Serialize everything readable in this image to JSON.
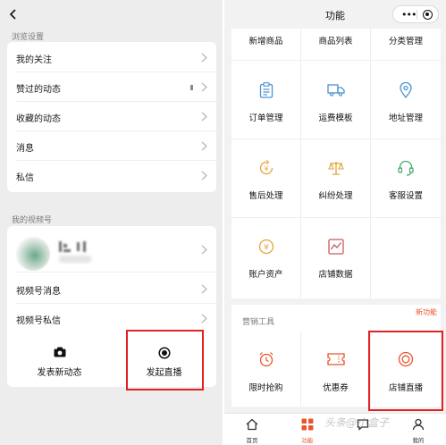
{
  "left_panel": {
    "browse_section_label": "浏览设置",
    "browse_items": [
      {
        "label": "我的关注"
      },
      {
        "label": "赞过的动态"
      },
      {
        "label": "收藏的动态"
      },
      {
        "label": "消息"
      },
      {
        "label": "私信"
      }
    ],
    "channels_section_label": "我的视频号",
    "channel_items": [
      {
        "label": "视频号消息"
      },
      {
        "label": "视频号私信"
      }
    ],
    "actions": {
      "post_label": "发表新动态",
      "live_label": "发起直播"
    }
  },
  "right_panel": {
    "title": "功能",
    "top_row": [
      "新增商品",
      "商品列表",
      "分类管理"
    ],
    "features": [
      {
        "label": "订单管理",
        "icon": "clipboard-icon"
      },
      {
        "label": "运费模板",
        "icon": "truck-icon"
      },
      {
        "label": "地址管理",
        "icon": "location-pin-icon"
      },
      {
        "label": "售后处理",
        "icon": "after-sales-icon"
      },
      {
        "label": "纠纷处理",
        "icon": "scale-icon"
      },
      {
        "label": "客服设置",
        "icon": "headset-icon"
      },
      {
        "label": "账户资产",
        "icon": "yen-icon"
      },
      {
        "label": "店铺数据",
        "icon": "chart-icon"
      }
    ],
    "marketing": {
      "title": "营销工具",
      "items": [
        {
          "label": "限时抢购",
          "icon": "alarm-clock-icon"
        },
        {
          "label": "优惠券",
          "icon": "coupon-icon"
        },
        {
          "label": "店铺直播",
          "icon": "live-icon"
        }
      ],
      "new_badge": "新功能"
    },
    "tabbar": [
      {
        "label": "首页",
        "icon": "home-icon"
      },
      {
        "label": "功能",
        "icon": "grid-icon",
        "active": true
      },
      {
        "label": "",
        "icon": "message-icon"
      },
      {
        "label": "我的",
        "icon": "user-icon"
      }
    ],
    "watermark": "头条@小盒子"
  },
  "colors": {
    "accent": "#e8542a",
    "highlight": "#e02222",
    "background_left": "#ededed",
    "background_right": "#f2f2f2"
  }
}
